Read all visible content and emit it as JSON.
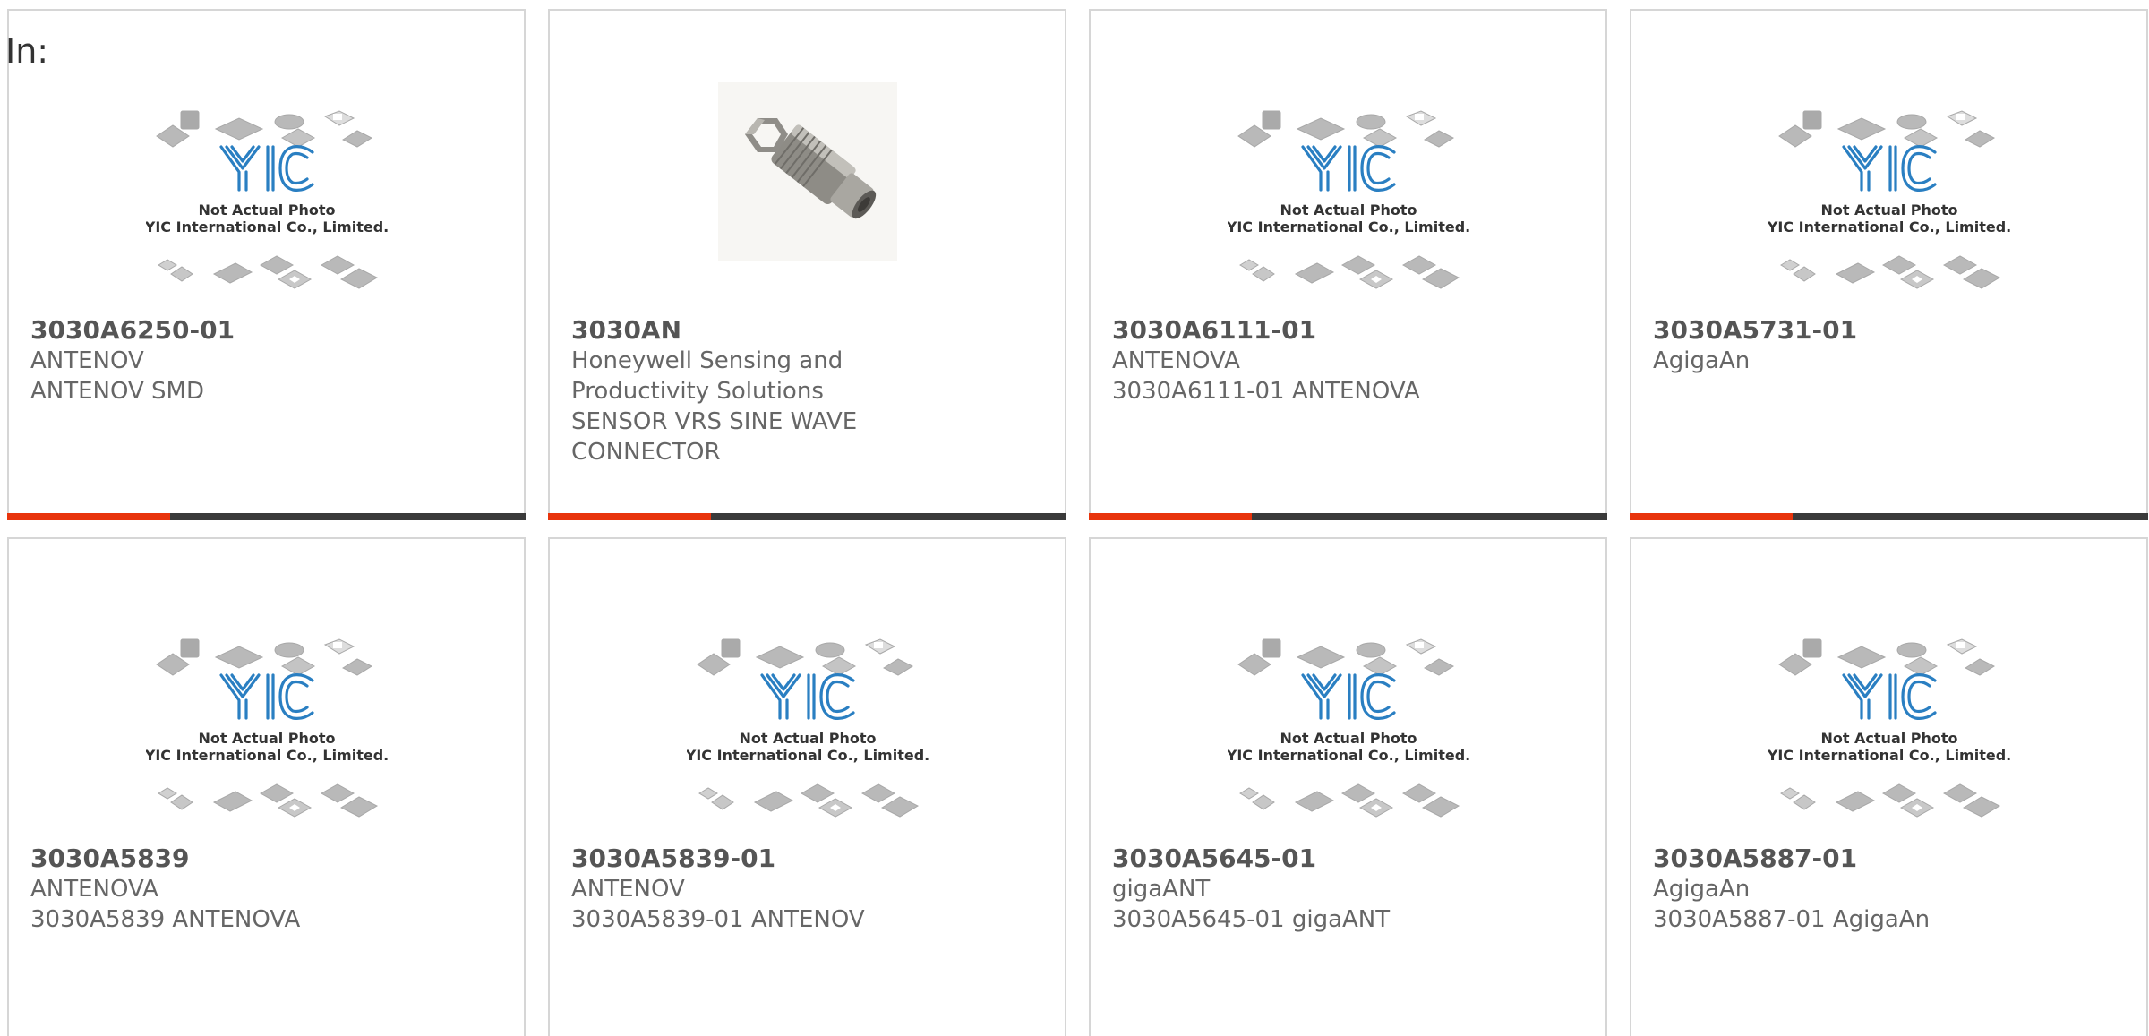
{
  "filter_label": "In:",
  "placeholder_caption": {
    "line1": "Not Actual Photo",
    "line2": "YIC International Co., Limited."
  },
  "colors": {
    "accent": "#e8340c",
    "bar": "#3a3a3a",
    "logo_blue": "#1f6fb0"
  },
  "products": [
    {
      "part_number": "3030A6250-01",
      "lines": [
        "ANTENOV",
        "ANTENOV SMD"
      ],
      "image": "placeholder"
    },
    {
      "part_number": "3030AN",
      "lines": [
        "Honeywell Sensing and",
        "Productivity Solutions",
        "SENSOR VRS SINE WAVE",
        "CONNECTOR"
      ],
      "image": "photo"
    },
    {
      "part_number": "3030A6111-01",
      "lines": [
        "ANTENOVA",
        "3030A6111-01 ANTENOVA"
      ],
      "image": "placeholder"
    },
    {
      "part_number": "3030A5731-01",
      "lines": [
        "AgigaAn"
      ],
      "image": "placeholder"
    },
    {
      "part_number": "3030A5839",
      "lines": [
        "ANTENOVA",
        "3030A5839 ANTENOVA"
      ],
      "image": "placeholder"
    },
    {
      "part_number": "3030A5839-01",
      "lines": [
        "ANTENOV",
        "3030A5839-01 ANTENOV"
      ],
      "image": "placeholder"
    },
    {
      "part_number": "3030A5645-01",
      "lines": [
        "gigaANT",
        "3030A5645-01 gigaANT"
      ],
      "image": "placeholder"
    },
    {
      "part_number": "3030A5887-01",
      "lines": [
        "AgigaAn",
        "3030A5887-01 AgigaAn"
      ],
      "image": "placeholder"
    }
  ]
}
